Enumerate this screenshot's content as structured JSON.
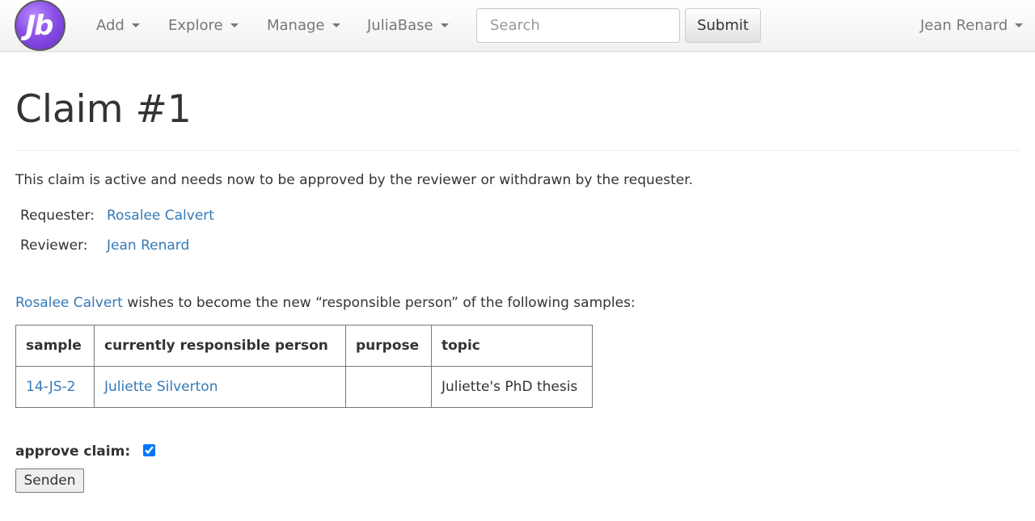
{
  "navbar": {
    "logo_text": "Jb",
    "menus": [
      {
        "label": "Add"
      },
      {
        "label": "Explore"
      },
      {
        "label": "Manage"
      },
      {
        "label": "JuliaBase"
      }
    ],
    "search_placeholder": "Search",
    "submit_label": "Submit",
    "user_menu": "Jean Renard"
  },
  "page": {
    "title": "Claim #1",
    "status_text": "This claim is active and needs now to be approved by the reviewer or withdrawn by the requester.",
    "requester_label": "Requester:",
    "requester": "Rosalee Calvert",
    "reviewer_label": "Reviewer:",
    "reviewer": "Jean Renard",
    "wish_user": "Rosalee Calvert",
    "wish_text": " wishes to become the new “responsible person” of the following samples:"
  },
  "table": {
    "headers": [
      "sample",
      "currently responsible person",
      "purpose",
      "topic"
    ],
    "rows": [
      {
        "sample": "14-JS-2",
        "person": "Juliette Silverton",
        "purpose": "",
        "topic": "Juliette's PhD thesis"
      }
    ]
  },
  "form": {
    "approve_label": "approve claim:",
    "approve_checked": true,
    "send_label": "Senden"
  },
  "colors": {
    "link": "#337ab7",
    "text": "#333333",
    "nav_text": "#777777",
    "logo": "#8a4fe6"
  }
}
